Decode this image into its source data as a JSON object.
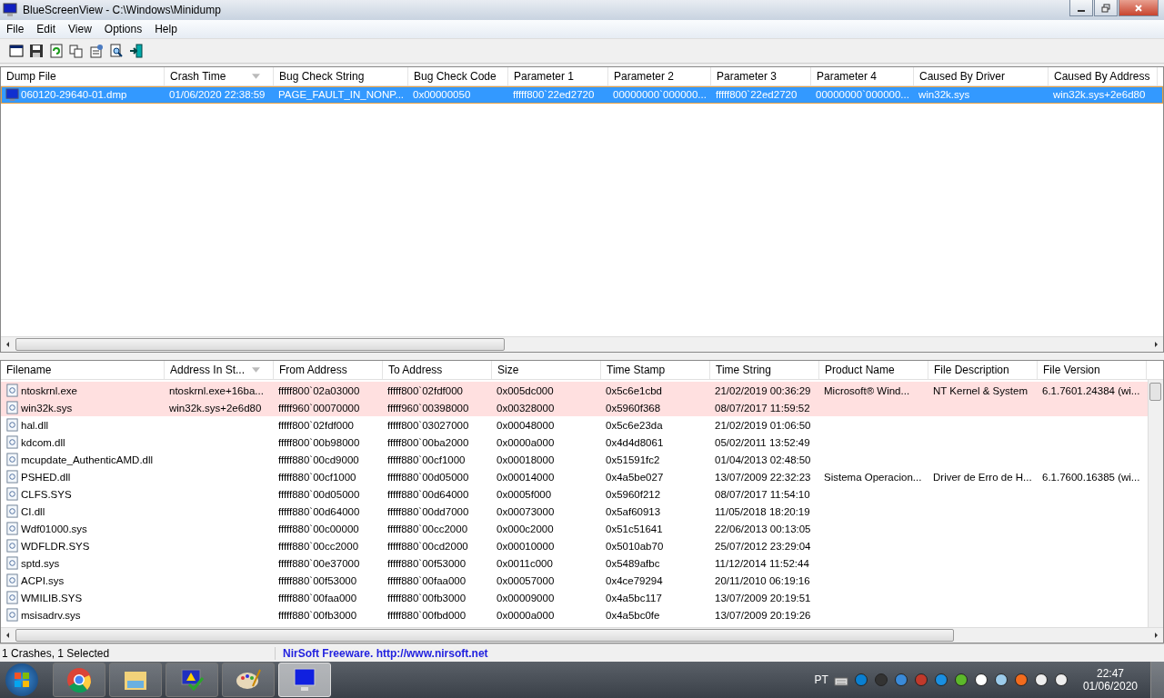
{
  "window": {
    "title": "BlueScreenView  -  C:\\Windows\\Minidump"
  },
  "menu": [
    "File",
    "Edit",
    "View",
    "Options",
    "Help"
  ],
  "crash_list": {
    "columns": [
      {
        "label": "Dump File",
        "sorted": false
      },
      {
        "label": "Crash Time",
        "sorted": true
      },
      {
        "label": "Bug Check String",
        "sorted": false
      },
      {
        "label": "Bug Check Code",
        "sorted": false
      },
      {
        "label": "Parameter 1",
        "sorted": false
      },
      {
        "label": "Parameter 2",
        "sorted": false
      },
      {
        "label": "Parameter 3",
        "sorted": false
      },
      {
        "label": "Parameter 4",
        "sorted": false
      },
      {
        "label": "Caused By Driver",
        "sorted": false
      },
      {
        "label": "Caused By Address",
        "sorted": false
      }
    ],
    "rows": [
      {
        "selected": true,
        "cells": [
          "060120-29640-01.dmp",
          "01/06/2020 22:38:59",
          "PAGE_FAULT_IN_NONP...",
          "0x00000050",
          "fffff800`22ed2720",
          "00000000`000000...",
          "fffff800`22ed2720",
          "00000000`000000...",
          "win32k.sys",
          "win32k.sys+2e6d80"
        ]
      }
    ]
  },
  "driver_list": {
    "columns": [
      {
        "label": "Filename",
        "sorted": false
      },
      {
        "label": "Address In St...",
        "sorted": true
      },
      {
        "label": "From Address",
        "sorted": false
      },
      {
        "label": "To Address",
        "sorted": false
      },
      {
        "label": "Size",
        "sorted": false
      },
      {
        "label": "Time Stamp",
        "sorted": false
      },
      {
        "label": "Time String",
        "sorted": false
      },
      {
        "label": "Product Name",
        "sorted": false
      },
      {
        "label": "File Description",
        "sorted": false
      },
      {
        "label": "File Version",
        "sorted": false
      }
    ],
    "rows": [
      {
        "highlighted": true,
        "cells": [
          "ntoskrnl.exe",
          "ntoskrnl.exe+16ba...",
          "fffff800`02a03000",
          "fffff800`02fdf000",
          "0x005dc000",
          "0x5c6e1cbd",
          "21/02/2019 00:36:29",
          "Microsoft® Wind...",
          "NT Kernel & System",
          "6.1.7601.24384 (wi..."
        ]
      },
      {
        "highlighted": true,
        "cells": [
          "win32k.sys",
          "win32k.sys+2e6d80",
          "fffff960`00070000",
          "fffff960`00398000",
          "0x00328000",
          "0x5960f368",
          "08/07/2017 11:59:52",
          "",
          "",
          ""
        ]
      },
      {
        "highlighted": false,
        "cells": [
          "hal.dll",
          "",
          "fffff800`02fdf000",
          "fffff800`03027000",
          "0x00048000",
          "0x5c6e23da",
          "21/02/2019 01:06:50",
          "",
          "",
          ""
        ]
      },
      {
        "highlighted": false,
        "cells": [
          "kdcom.dll",
          "",
          "fffff800`00b98000",
          "fffff800`00ba2000",
          "0x0000a000",
          "0x4d4d8061",
          "05/02/2011 13:52:49",
          "",
          "",
          ""
        ]
      },
      {
        "highlighted": false,
        "cells": [
          "mcupdate_AuthenticAMD.dll",
          "",
          "fffff880`00cd9000",
          "fffff880`00cf1000",
          "0x00018000",
          "0x51591fc2",
          "01/04/2013 02:48:50",
          "",
          "",
          ""
        ]
      },
      {
        "highlighted": false,
        "cells": [
          "PSHED.dll",
          "",
          "fffff880`00cf1000",
          "fffff880`00d05000",
          "0x00014000",
          "0x4a5be027",
          "13/07/2009 22:32:23",
          "Sistema Operacion...",
          "Driver de Erro de H...",
          "6.1.7600.16385 (wi..."
        ]
      },
      {
        "highlighted": false,
        "cells": [
          "CLFS.SYS",
          "",
          "fffff880`00d05000",
          "fffff880`00d64000",
          "0x0005f000",
          "0x5960f212",
          "08/07/2017 11:54:10",
          "",
          "",
          ""
        ]
      },
      {
        "highlighted": false,
        "cells": [
          "CI.dll",
          "",
          "fffff880`00d64000",
          "fffff880`00dd7000",
          "0x00073000",
          "0x5af60913",
          "11/05/2018 18:20:19",
          "",
          "",
          ""
        ]
      },
      {
        "highlighted": false,
        "cells": [
          "Wdf01000.sys",
          "",
          "fffff880`00c00000",
          "fffff880`00cc2000",
          "0x000c2000",
          "0x51c51641",
          "22/06/2013 00:13:05",
          "",
          "",
          ""
        ]
      },
      {
        "highlighted": false,
        "cells": [
          "WDFLDR.SYS",
          "",
          "fffff880`00cc2000",
          "fffff880`00cd2000",
          "0x00010000",
          "0x5010ab70",
          "25/07/2012 23:29:04",
          "",
          "",
          ""
        ]
      },
      {
        "highlighted": false,
        "cells": [
          "sptd.sys",
          "",
          "fffff880`00e37000",
          "fffff880`00f53000",
          "0x0011c000",
          "0x5489afbc",
          "11/12/2014 11:52:44",
          "",
          "",
          ""
        ]
      },
      {
        "highlighted": false,
        "cells": [
          "ACPI.sys",
          "",
          "fffff880`00f53000",
          "fffff880`00faa000",
          "0x00057000",
          "0x4ce79294",
          "20/11/2010 06:19:16",
          "",
          "",
          ""
        ]
      },
      {
        "highlighted": false,
        "cells": [
          "WMILIB.SYS",
          "",
          "fffff880`00faa000",
          "fffff880`00fb3000",
          "0x00009000",
          "0x4a5bc117",
          "13/07/2009 20:19:51",
          "",
          "",
          ""
        ]
      },
      {
        "highlighted": false,
        "cells": [
          "msisadrv.sys",
          "",
          "fffff880`00fb3000",
          "fffff880`00fbd000",
          "0x0000a000",
          "0x4a5bc0fe",
          "13/07/2009 20:19:26",
          "",
          "",
          ""
        ]
      }
    ]
  },
  "status_bar": {
    "count": "1 Crashes, 1 Selected",
    "credit": "NirSoft Freeware.  http://www.nirsoft.net"
  },
  "taskbar": {
    "apps": [
      {
        "kind": "browser",
        "selected": false
      },
      {
        "kind": "folder",
        "selected": false
      },
      {
        "kind": "monitor-check",
        "selected": false
      },
      {
        "kind": "palette",
        "selected": false
      },
      {
        "kind": "monitor",
        "selected": true
      }
    ],
    "language": "PT",
    "time": "22:47",
    "date": "01/06/2020"
  }
}
